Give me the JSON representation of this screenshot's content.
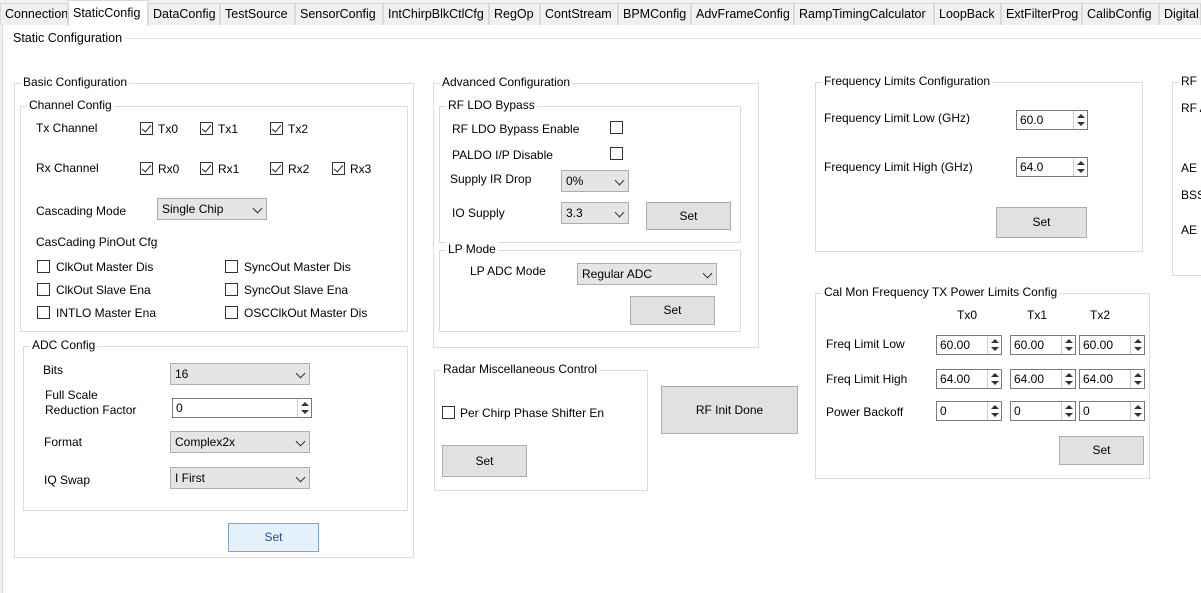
{
  "tabs": [
    "Connection",
    "StaticConfig",
    "DataConfig",
    "TestSource",
    "SensorConfig",
    "IntChirpBlkCtlCfg",
    "RegOp",
    "ContStream",
    "BPMConfig",
    "AdvFrameConfig",
    "RampTimingCalculator",
    "LoopBack",
    "ExtFilterProg",
    "CalibConfig",
    "Digital"
  ],
  "page_title": "Static Configuration",
  "basic": {
    "title": "Basic Configuration",
    "channel_title": "Channel Config",
    "tx_label": "Tx Channel",
    "tx": [
      {
        "label": "Tx0",
        "checked": true
      },
      {
        "label": "Tx1",
        "checked": true
      },
      {
        "label": "Tx2",
        "checked": true
      }
    ],
    "rx_label": "Rx Channel",
    "rx": [
      {
        "label": "Rx0",
        "checked": true
      },
      {
        "label": "Rx1",
        "checked": true
      },
      {
        "label": "Rx2",
        "checked": true
      },
      {
        "label": "Rx3",
        "checked": true
      }
    ],
    "cascading_label": "Cascading Mode",
    "cascading_value": "Single Chip",
    "pinout_label": "CasCading PinOut Cfg",
    "pinout": [
      {
        "label": "ClkOut Master Dis",
        "checked": false
      },
      {
        "label": "SyncOut Master Dis",
        "checked": false
      },
      {
        "label": "ClkOut Slave Ena",
        "checked": false
      },
      {
        "label": "SyncOut Slave Ena",
        "checked": false
      },
      {
        "label": "INTLO Master Ena",
        "checked": false
      },
      {
        "label": "OSCClkOut Master Dis",
        "checked": false
      }
    ],
    "adc_title": "ADC Config",
    "bits_label": "Bits",
    "bits_value": "16",
    "fsr_label_1": "Full Scale",
    "fsr_label_2": "Reduction Factor",
    "fsr_value": "0",
    "format_label": "Format",
    "format_value": "Complex2x",
    "iq_label": "IQ Swap",
    "iq_value": "I First",
    "set_label": "Set"
  },
  "advanced": {
    "title": "Advanced Configuration",
    "rfldo_title": "RF LDO Bypass",
    "rfldo_enable_label": "RF LDO Bypass Enable",
    "rfldo_enable_checked": false,
    "paldo_label": "PALDO I/P Disable",
    "paldo_checked": false,
    "supply_ir_label": "Supply IR Drop",
    "supply_ir_value": "0%",
    "io_supply_label": "IO Supply",
    "io_supply_value": "3.3",
    "set_label": "Set",
    "lp_title": "LP Mode",
    "lp_adc_label": "LP ADC Mode",
    "lp_adc_value": "Regular ADC",
    "lp_set_label": "Set"
  },
  "radar": {
    "title": "Radar Miscellaneous Control",
    "phase_label": "Per Chirp Phase Shifter En",
    "phase_checked": false,
    "set_label": "Set"
  },
  "rf_init_label": "RF Init Done",
  "freq": {
    "title": "Frequency Limits Configuration",
    "low_label": "Frequency Limit Low (GHz)",
    "low_value": "60.0",
    "high_label": "Frequency Limit High (GHz)",
    "high_value": "64.0",
    "set_label": "Set"
  },
  "calmon": {
    "title": "Cal Mon Frequency TX Power Limits Config",
    "cols": [
      "Tx0",
      "Tx1",
      "Tx2"
    ],
    "rows": [
      {
        "label": "Freq Limit Low",
        "values": [
          "60.00",
          "60.00",
          "60.00"
        ]
      },
      {
        "label": "Freq Limit High",
        "values": [
          "64.00",
          "64.00",
          "64.00"
        ]
      },
      {
        "label": "Power Backoff",
        "values": [
          "0",
          "0",
          "0"
        ]
      }
    ],
    "set_label": "Set"
  },
  "partial": {
    "title": "RF I",
    "items": [
      "RF A",
      "AE I",
      "BSS",
      "AE C"
    ]
  }
}
